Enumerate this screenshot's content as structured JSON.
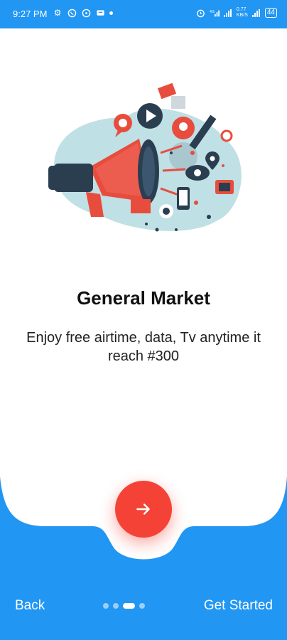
{
  "status_bar": {
    "time": "9:27 PM",
    "left_icons": [
      "settings-icon",
      "whatsapp-icon",
      "chat-icon",
      "message-icon",
      "notification-dot"
    ],
    "right_icons": [
      "alarm-icon",
      "signal-4g-icon",
      "signal-bars-icon",
      "data-speed-icon",
      "signal-bars-icon",
      "battery-icon"
    ],
    "data_speed": "0.77\nKB/S",
    "battery": "44"
  },
  "onboarding": {
    "title": "General Market",
    "subtitle": "Enjoy free airtime, data, Tv anytime it reach #300"
  },
  "footer": {
    "back_label": "Back",
    "get_started_label": "Get Started",
    "page_count": 4,
    "active_page_index": 2
  },
  "colors": {
    "primary_blue": "#2196f3",
    "accent_red": "#f44336",
    "illustration_teal": "#bfe0e4",
    "illustration_navy": "#2b3e50"
  }
}
